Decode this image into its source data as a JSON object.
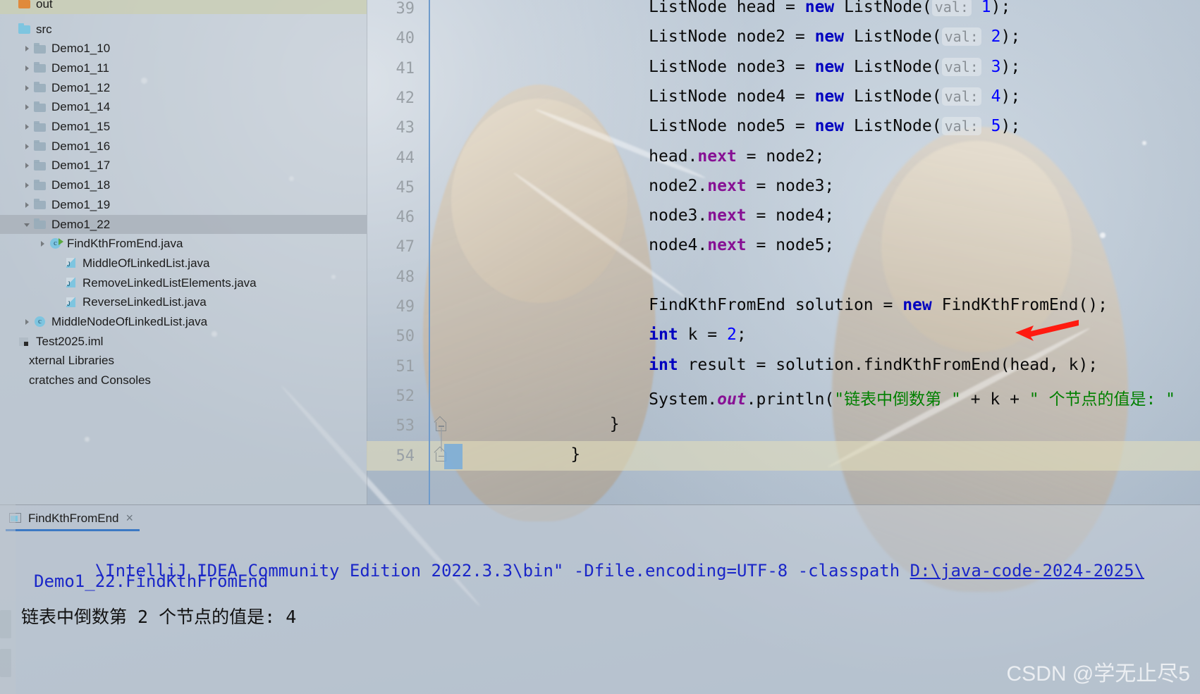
{
  "app": {
    "ide": "IntelliJ IDEA Community Edition 2022.3.3",
    "accent_color": "#3c79c4",
    "keyword_color": "#0000C0",
    "string_color": "#008000",
    "field_color": "#871094",
    "number_color": "#0000FF",
    "console_color": "#1A26C8",
    "annotation_arrow_color": "#FF0000"
  },
  "sidebar": {
    "items": [
      {
        "label": "out",
        "indent": 0,
        "icon": "folder-orange-icon",
        "arrow": "none",
        "selected": false,
        "clipped_top": true
      },
      {
        "label": "src",
        "indent": 0,
        "icon": "folder-blue-icon",
        "arrow": "none",
        "selected": false
      },
      {
        "label": "Demo1_10",
        "indent": 1,
        "icon": "folder-icon",
        "arrow": "closed",
        "selected": false
      },
      {
        "label": "Demo1_11",
        "indent": 1,
        "icon": "folder-icon",
        "arrow": "closed",
        "selected": false
      },
      {
        "label": "Demo1_12",
        "indent": 1,
        "icon": "folder-icon",
        "arrow": "closed",
        "selected": false
      },
      {
        "label": "Demo1_14",
        "indent": 1,
        "icon": "folder-icon",
        "arrow": "closed",
        "selected": false
      },
      {
        "label": "Demo1_15",
        "indent": 1,
        "icon": "folder-icon",
        "arrow": "closed",
        "selected": false
      },
      {
        "label": "Demo1_16",
        "indent": 1,
        "icon": "folder-icon",
        "arrow": "closed",
        "selected": false
      },
      {
        "label": "Demo1_17",
        "indent": 1,
        "icon": "folder-icon",
        "arrow": "closed",
        "selected": false
      },
      {
        "label": "Demo1_18",
        "indent": 1,
        "icon": "folder-icon",
        "arrow": "closed",
        "selected": false
      },
      {
        "label": "Demo1_19",
        "indent": 1,
        "icon": "folder-icon",
        "arrow": "closed",
        "selected": false
      },
      {
        "label": "Demo1_22",
        "indent": 1,
        "icon": "folder-icon",
        "arrow": "open",
        "selected": true
      },
      {
        "label": "FindKthFromEnd.java",
        "indent": 2,
        "icon": "java-class-runnable-icon",
        "arrow": "closed",
        "selected": false
      },
      {
        "label": "MiddleOfLinkedList.java",
        "indent": 3,
        "icon": "java-file-icon",
        "arrow": "none",
        "selected": false
      },
      {
        "label": "RemoveLinkedListElements.java",
        "indent": 3,
        "icon": "java-file-icon",
        "arrow": "none",
        "selected": false
      },
      {
        "label": "ReverseLinkedList.java",
        "indent": 3,
        "icon": "java-file-icon",
        "arrow": "none",
        "selected": false
      },
      {
        "label": "MiddleNodeOfLinkedList.java",
        "indent": 1,
        "icon": "java-class-icon",
        "arrow": "closed",
        "selected": false
      },
      {
        "label": "Test2025.iml",
        "indent": 0,
        "icon": "iml-file-icon",
        "arrow": "none",
        "selected": false
      },
      {
        "label": "xternal Libraries",
        "indent": -1,
        "icon": "none",
        "arrow": "none",
        "selected": false
      },
      {
        "label": "cratches and Consoles",
        "indent": -1,
        "icon": "none",
        "arrow": "none",
        "selected": false
      }
    ]
  },
  "editor": {
    "first_visible_line": 39,
    "lines": [
      {
        "n": 39,
        "clipped": true,
        "tokens": [
          {
            "t": "            ListNode head = ",
            "c": "plain"
          },
          {
            "t": "new",
            "c": "kw"
          },
          {
            "t": " ListNode(",
            "c": "plain"
          },
          {
            "t": "val:",
            "c": "hint"
          },
          {
            "t": " ",
            "c": "plain"
          },
          {
            "t": "1",
            "c": "num"
          },
          {
            "t": ");",
            "c": "plain"
          }
        ]
      },
      {
        "n": 40,
        "tokens": [
          {
            "t": "            ListNode node2 = ",
            "c": "plain"
          },
          {
            "t": "new",
            "c": "kw"
          },
          {
            "t": " ListNode(",
            "c": "plain"
          },
          {
            "t": "val:",
            "c": "hint"
          },
          {
            "t": " ",
            "c": "plain"
          },
          {
            "t": "2",
            "c": "num"
          },
          {
            "t": ");",
            "c": "plain"
          }
        ]
      },
      {
        "n": 41,
        "tokens": [
          {
            "t": "            ListNode node3 = ",
            "c": "plain"
          },
          {
            "t": "new",
            "c": "kw"
          },
          {
            "t": " ListNode(",
            "c": "plain"
          },
          {
            "t": "val:",
            "c": "hint"
          },
          {
            "t": " ",
            "c": "plain"
          },
          {
            "t": "3",
            "c": "num"
          },
          {
            "t": ");",
            "c": "plain"
          }
        ]
      },
      {
        "n": 42,
        "tokens": [
          {
            "t": "            ListNode node4 = ",
            "c": "plain"
          },
          {
            "t": "new",
            "c": "kw"
          },
          {
            "t": " ListNode(",
            "c": "plain"
          },
          {
            "t": "val:",
            "c": "hint"
          },
          {
            "t": " ",
            "c": "plain"
          },
          {
            "t": "4",
            "c": "num"
          },
          {
            "t": ");",
            "c": "plain"
          }
        ]
      },
      {
        "n": 43,
        "tokens": [
          {
            "t": "            ListNode node5 = ",
            "c": "plain"
          },
          {
            "t": "new",
            "c": "kw"
          },
          {
            "t": " ListNode(",
            "c": "plain"
          },
          {
            "t": "val:",
            "c": "hint"
          },
          {
            "t": " ",
            "c": "plain"
          },
          {
            "t": "5",
            "c": "num"
          },
          {
            "t": ");",
            "c": "plain"
          }
        ]
      },
      {
        "n": 44,
        "tokens": [
          {
            "t": "            head.",
            "c": "plain"
          },
          {
            "t": "next",
            "c": "fld"
          },
          {
            "t": " = node2;",
            "c": "plain"
          }
        ]
      },
      {
        "n": 45,
        "tokens": [
          {
            "t": "            node2.",
            "c": "plain"
          },
          {
            "t": "next",
            "c": "fld"
          },
          {
            "t": " = node3;",
            "c": "plain"
          }
        ]
      },
      {
        "n": 46,
        "tokens": [
          {
            "t": "            node3.",
            "c": "plain"
          },
          {
            "t": "next",
            "c": "fld"
          },
          {
            "t": " = node4;",
            "c": "plain"
          }
        ]
      },
      {
        "n": 47,
        "tokens": [
          {
            "t": "            node4.",
            "c": "plain"
          },
          {
            "t": "next",
            "c": "fld"
          },
          {
            "t": " = node5;",
            "c": "plain"
          }
        ]
      },
      {
        "n": 48,
        "tokens": []
      },
      {
        "n": 49,
        "tokens": [
          {
            "t": "            FindKthFromEnd solution = ",
            "c": "plain"
          },
          {
            "t": "new",
            "c": "kw"
          },
          {
            "t": " FindKthFromEnd();",
            "c": "plain"
          }
        ]
      },
      {
        "n": 50,
        "tokens": [
          {
            "t": "            ",
            "c": "plain"
          },
          {
            "t": "int",
            "c": "kw"
          },
          {
            "t": " k = ",
            "c": "plain"
          },
          {
            "t": "2",
            "c": "num"
          },
          {
            "t": ";",
            "c": "plain"
          }
        ]
      },
      {
        "n": 51,
        "tokens": [
          {
            "t": "            ",
            "c": "plain"
          },
          {
            "t": "int",
            "c": "kw"
          },
          {
            "t": " result = solution.findKthFromEnd(head, k);",
            "c": "plain"
          }
        ]
      },
      {
        "n": 52,
        "clipped": true,
        "tokens": [
          {
            "t": "            System.",
            "c": "plain"
          },
          {
            "t": "out",
            "c": "fld-i"
          },
          {
            "t": ".println(",
            "c": "plain"
          },
          {
            "t": "\"链表中倒数第 \"",
            "c": "str"
          },
          {
            "t": " + k + ",
            "c": "plain"
          },
          {
            "t": "\" 个节点的值是: \"",
            "c": "str"
          }
        ]
      },
      {
        "n": 53,
        "fold": true,
        "tokens": [
          {
            "t": "        }",
            "c": "plain"
          }
        ]
      },
      {
        "n": 54,
        "fold": true,
        "caret": true,
        "tokens": [
          {
            "t": "    }",
            "c": "plain"
          }
        ]
      }
    ]
  },
  "console": {
    "tab_label": "FindKthFromEnd",
    "close_label": "×",
    "output": [
      {
        "text": "\\IntelliJ IDEA Community Edition 2022.3.3\\bin\" -Dfile.encoding=UTF-8 -classpath ",
        "style": "blue",
        "link_tail": "D:\\java-code-2024-2025\\"
      },
      {
        "text": "Demo1_22.FindKthFromEnd",
        "style": "blue"
      },
      {
        "text": "链表中倒数第 2 个节点的值是: 4",
        "style": "black"
      }
    ]
  },
  "watermark": {
    "text": "CSDN @学无止尽5"
  }
}
